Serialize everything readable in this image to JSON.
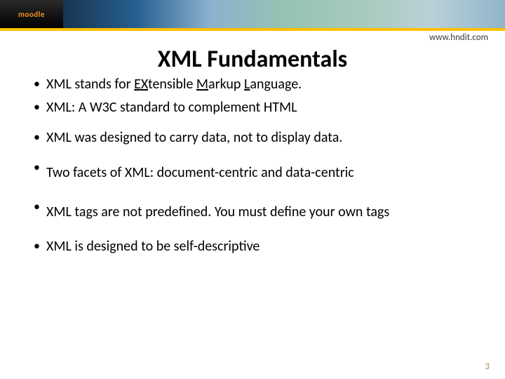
{
  "header": {
    "logo_text": "moodle",
    "url": "www.hndit.com"
  },
  "title": "XML Fundamentals",
  "bullets": {
    "b1_pre": "XML stands for ",
    "b1_e": "E",
    "b1_x": "X",
    "b1_mid": "tensible ",
    "b1_m": "M",
    "b1_arkup": "arkup ",
    "b1_l": "L",
    "b1_ang": "anguage.",
    "b2": "XML: A W3C standard to complement HTML",
    "b3": "XML was designed to carry data, not to display data.",
    "b4": "Two facets of XML: document-centric and data-centric",
    "b5": "XML tags are not predefined. You must define your own tags",
    "b6": "XML is designed to be self-descriptive"
  },
  "page_number": "3"
}
